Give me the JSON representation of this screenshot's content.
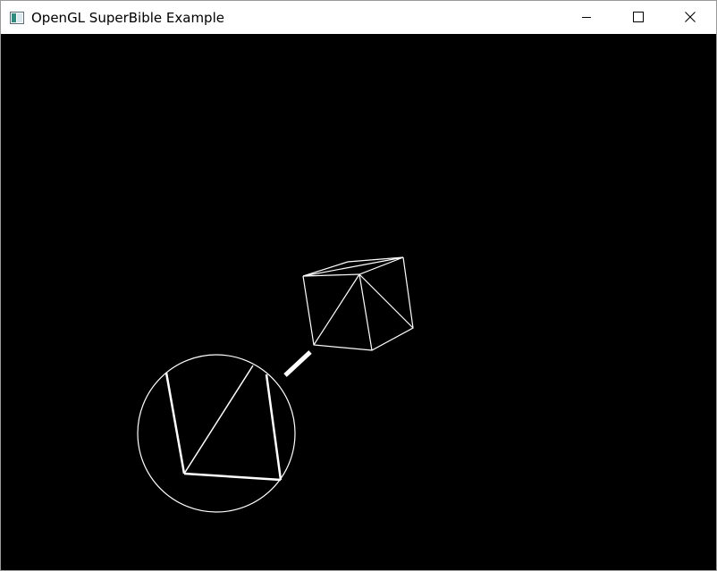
{
  "window": {
    "title": "OpenGL SuperBible Example",
    "icon": "opengl-app-icon",
    "buttons": {
      "minimize": "minimize-icon",
      "maximize": "maximize-icon",
      "close": "close-icon"
    }
  },
  "scene": {
    "background": "#000000",
    "line_color": "#ffffff",
    "objects": [
      "wireframe-cube",
      "magnifier-lens",
      "magnifier-handle"
    ]
  }
}
